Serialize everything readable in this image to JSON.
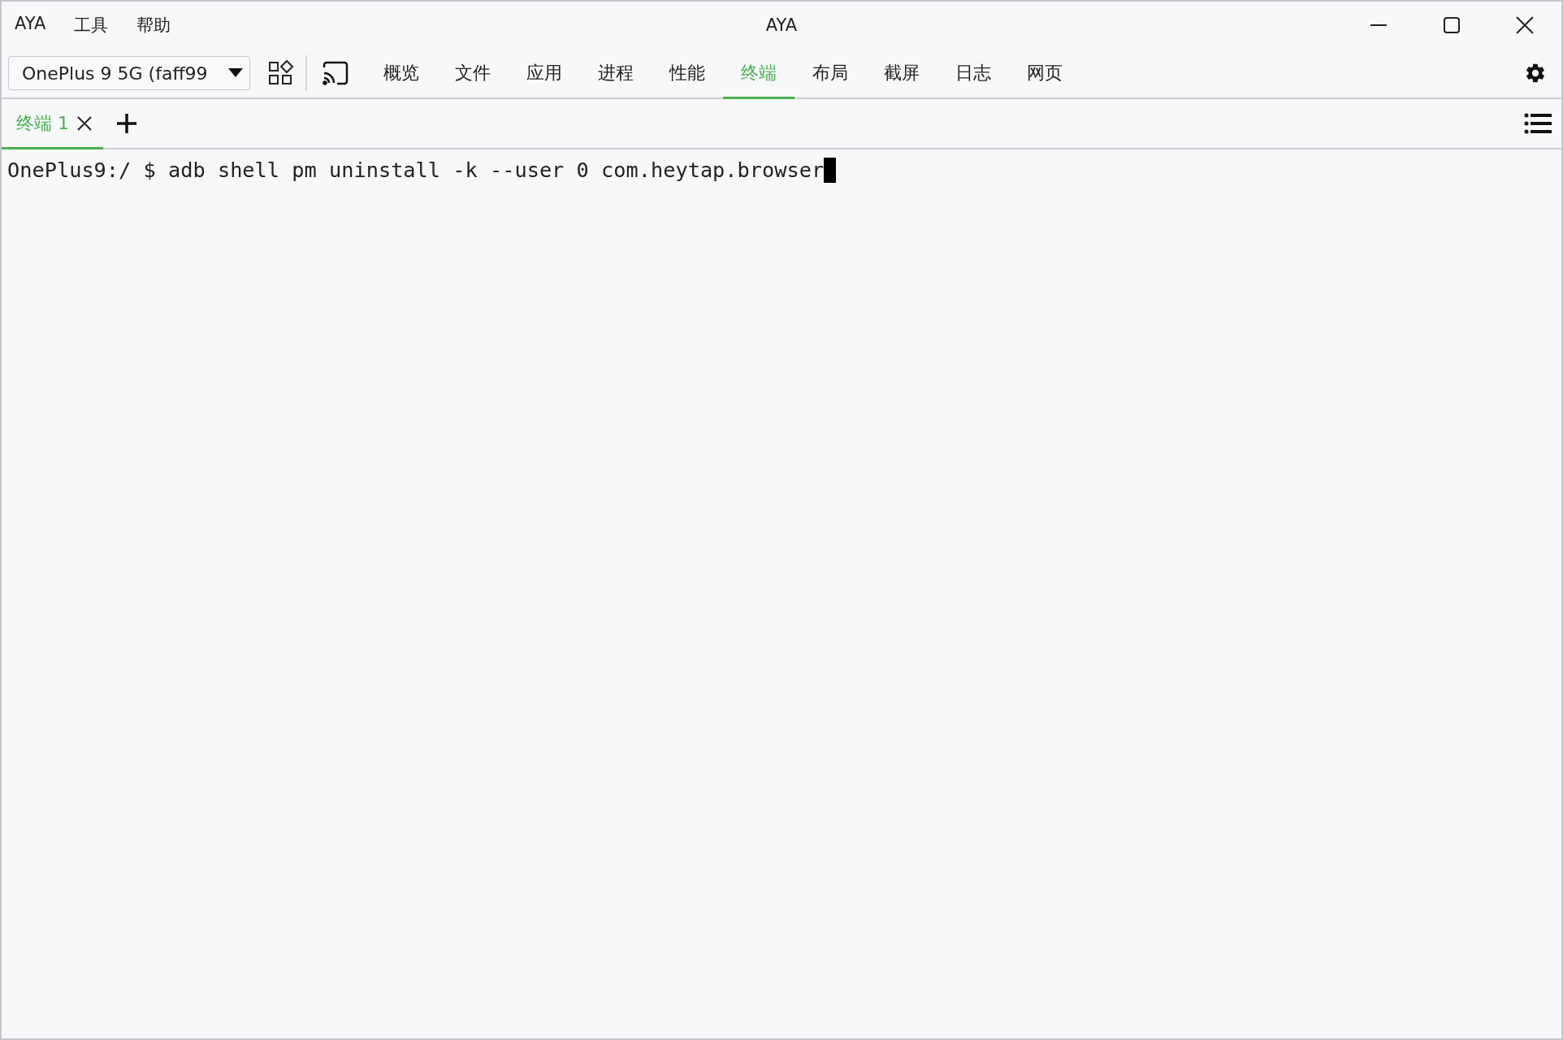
{
  "window": {
    "title": "AYA"
  },
  "menu": [
    "AYA",
    "工具",
    "帮助"
  ],
  "device_select": {
    "value": "OnePlus 9 5G (faff99"
  },
  "nav_tabs": [
    {
      "label": "概览",
      "selected": false
    },
    {
      "label": "文件",
      "selected": false
    },
    {
      "label": "应用",
      "selected": false
    },
    {
      "label": "进程",
      "selected": false
    },
    {
      "label": "性能",
      "selected": false
    },
    {
      "label": "终端",
      "selected": true
    },
    {
      "label": "布局",
      "selected": false
    },
    {
      "label": "截屏",
      "selected": false
    },
    {
      "label": "日志",
      "selected": false
    },
    {
      "label": "网页",
      "selected": false
    }
  ],
  "terminal_tabs": [
    {
      "label": "终端 1",
      "selected": true
    }
  ],
  "terminal": {
    "line": "OnePlus9:/ $ adb shell pm uninstall -k --user 0 com.heytap.browser"
  }
}
